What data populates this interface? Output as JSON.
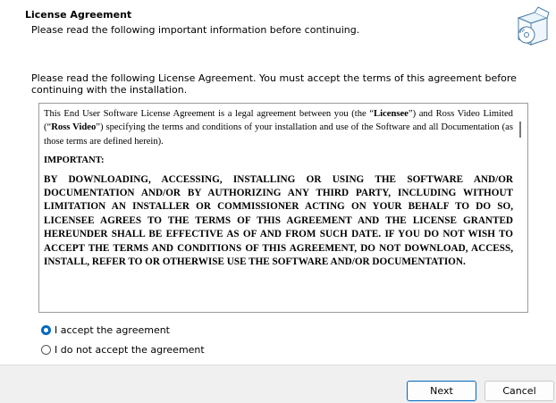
{
  "header": {
    "title": "License Agreement",
    "subtitle": "Please read the following important information before continuing."
  },
  "intro": "Please read the following License Agreement. You must accept the terms of this agreement before continuing with the installation.",
  "license": {
    "p1_a": "This End User Software License Agreement is a legal agreement between you (the “",
    "p1_licensee": "Licensee",
    "p1_b": "”) and Ross Video Limited (“",
    "p1_ross": "Ross Video",
    "p1_c": "”) specifying the terms and conditions of your installation and use of the Software and all Documentation (as those terms are defined herein).",
    "important": "IMPORTANT:",
    "caps": "BY DOWNLOADING, ACCESSING, INSTALLING OR USING THE SOFTWARE AND/OR DOCUMENTATION AND/OR BY AUTHORIZING ANY THIRD PARTY, INCLUDING WITHOUT LIMITATION AN INSTALLER OR COMMISSIONER ACTING ON YOUR BEHALF TO DO SO, LICENSEE AGREES TO THE TERMS OF THIS AGREEMENT AND THE LICENSE GRANTED HEREUNDER SHALL BE EFFECTIVE AS OF AND FROM SUCH DATE. IF YOU DO NOT WISH TO ACCEPT THE TERMS AND CONDITIONS OF THIS AGREEMENT, DO NOT DOWNLOAD, ACCESS, INSTALL, REFER TO OR OTHERWISE USE THE SOFTWARE AND/OR DOCUMENTATION."
  },
  "options": {
    "accept": "I accept the agreement",
    "decline": "I do not accept the agreement",
    "selected": "accept"
  },
  "buttons": {
    "next": "Next",
    "cancel": "Cancel"
  },
  "colors": {
    "accent": "#0067c0"
  }
}
